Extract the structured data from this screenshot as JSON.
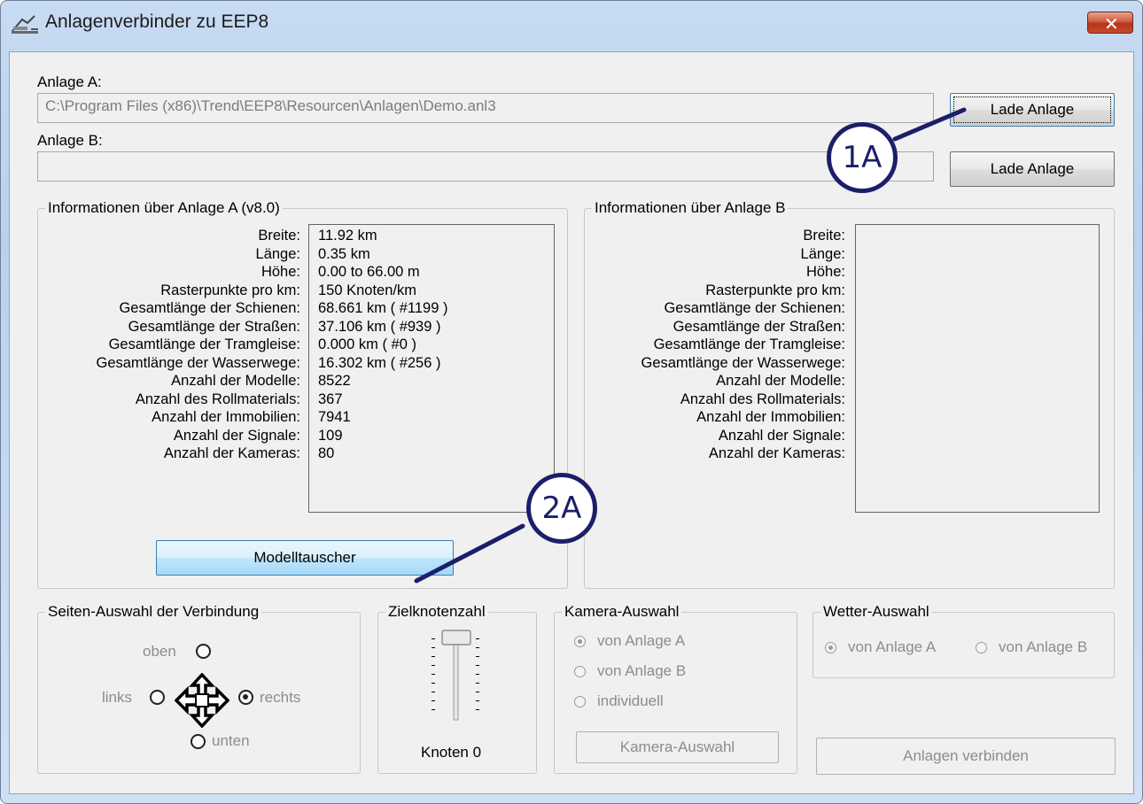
{
  "window": {
    "title": "Anlagenverbinder zu EEP8",
    "app_icon": "railway-app-icon",
    "close_icon": "close-icon"
  },
  "anlage_a": {
    "label": "Anlage A:",
    "path": "C:\\Program Files (x86)\\Trend\\EEP8\\Resourcen\\Anlagen\\Demo.anl3",
    "load_button": "Lade Anlage"
  },
  "anlage_b": {
    "label": "Anlage B:",
    "path": "",
    "load_button": "Lade Anlage"
  },
  "info_a": {
    "title": "Informationen über Anlage A (v8.0)",
    "rows": [
      {
        "label": "Breite:",
        "value": "11.92 km"
      },
      {
        "label": "Länge:",
        "value": "0.35 km"
      },
      {
        "label": "Höhe:",
        "value": "0.00 to 66.00 m"
      },
      {
        "label": "Rasterpunkte pro km:",
        "value": "150 Knoten/km"
      },
      {
        "label": "Gesamtlänge der Schienen:",
        "value": "68.661 km ( #1199 )"
      },
      {
        "label": "Gesamtlänge der Straßen:",
        "value": "37.106 km ( #939 )"
      },
      {
        "label": "Gesamtlänge der Tramgleise:",
        "value": "0.000 km ( #0 )"
      },
      {
        "label": "Gesamtlänge der Wasserwege:",
        "value": "16.302 km ( #256 )"
      },
      {
        "label": "Anzahl der Modelle:",
        "value": "8522"
      },
      {
        "label": "Anzahl des Rollmaterials:",
        "value": "367"
      },
      {
        "label": "Anzahl der Immobilien:",
        "value": "7941"
      },
      {
        "label": "Anzahl der Signale:",
        "value": "109"
      },
      {
        "label": "Anzahl der Kameras:",
        "value": "80"
      }
    ],
    "button": "Modelltauscher"
  },
  "info_b": {
    "title": "Informationen über Anlage B",
    "rows": [
      {
        "label": "Breite:"
      },
      {
        "label": "Länge:"
      },
      {
        "label": "Höhe:"
      },
      {
        "label": "Rasterpunkte pro km:"
      },
      {
        "label": "Gesamtlänge der Schienen:"
      },
      {
        "label": "Gesamtlänge der Straßen:"
      },
      {
        "label": "Gesamtlänge der Tramgleise:"
      },
      {
        "label": "Gesamtlänge der Wasserwege:"
      },
      {
        "label": "Anzahl der Modelle:"
      },
      {
        "label": "Anzahl des Rollmaterials:"
      },
      {
        "label": "Anzahl der Immobilien:"
      },
      {
        "label": "Anzahl der Signale:"
      },
      {
        "label": "Anzahl der Kameras:"
      }
    ]
  },
  "seiten": {
    "title": "Seiten-Auswahl der Verbindung",
    "oben": "oben",
    "links": "links",
    "rechts": "rechts",
    "unten": "unten",
    "selected": "rechts",
    "center_icon": "move-arrows-icon"
  },
  "ziel": {
    "title": "Zielknotenzahl",
    "value_label": "Knoten 0",
    "slider_value": 0
  },
  "kamera": {
    "title": "Kamera-Auswahl",
    "options": [
      "von Anlage A",
      "von Anlage B",
      "individuell"
    ],
    "selected": "von Anlage A",
    "button": "Kamera-Auswahl"
  },
  "wetter": {
    "title": "Wetter-Auswahl",
    "options": [
      "von Anlage A",
      "von Anlage B"
    ],
    "selected": "von Anlage A"
  },
  "connect_button": "Anlagen verbinden",
  "callouts": {
    "c1": "1A",
    "c2": "2A",
    "color": "#1b1f6a"
  },
  "colors": {
    "frame": "#c4d9f2",
    "close": "#c8482a",
    "hot_button": "#bee6fd"
  }
}
